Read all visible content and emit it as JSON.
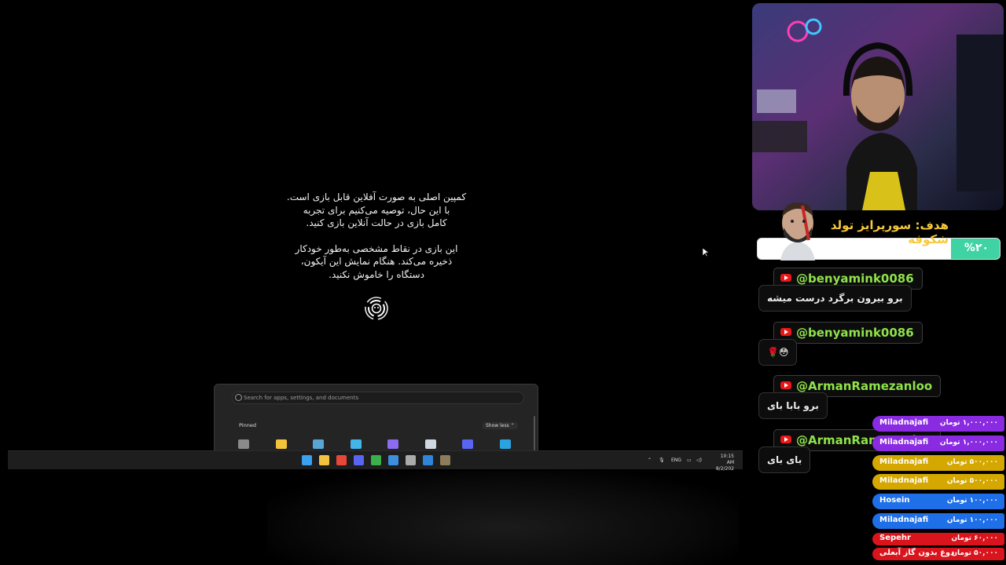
{
  "game": {
    "notice_paragraph_1": [
      "کمپین اصلی به صورت آفلاین قابل بازی است.",
      "با این حال، توصیه می‌کنیم برای تجربه",
      "کامل بازی در حالت آنلاین بازی کنید."
    ],
    "notice_paragraph_2": [
      "این بازی در نقاط مشخصی به‌طور خودکار",
      "ذخیره می‌کند. هنگام نمایش این آیکون،",
      "دستگاه را خاموش نکنید."
    ],
    "spinner_icon": "swirl-save-icon"
  },
  "start_menu": {
    "search_placeholder": "Search for apps, settings, and documents",
    "pinned_label": "Pinned",
    "show_less_label": "Show less ⌃",
    "apps": [
      {
        "icon": "settings-icon",
        "color": "#8a8a8a"
      },
      {
        "icon": "folder-icon",
        "color": "#f3c43a"
      },
      {
        "icon": "app-icon",
        "color": "#58a6d6"
      },
      {
        "icon": "monitor-icon",
        "color": "#42b6e8"
      },
      {
        "icon": "app-icon",
        "color": "#8b6cf0"
      },
      {
        "icon": "steam-icon",
        "color": "#cfd8e0"
      },
      {
        "icon": "discord-icon",
        "color": "#5865f2"
      },
      {
        "icon": "telegram-icon",
        "color": "#2aa3e0"
      }
    ]
  },
  "taskbar": {
    "apps": [
      {
        "icon": "windows-start-icon",
        "color": "#3aa0f0"
      },
      {
        "icon": "file-explorer-icon",
        "color": "#f1c33f"
      },
      {
        "icon": "chrome-icon",
        "color": "#e9463a"
      },
      {
        "icon": "discord-icon",
        "color": "#5865f2"
      },
      {
        "icon": "xbox-icon",
        "color": "#3bb04a"
      },
      {
        "icon": "app-icon",
        "color": "#3d8de0"
      },
      {
        "icon": "obs-icon",
        "color": "#aaaaaa"
      },
      {
        "icon": "mail-icon",
        "color": "#2f86d8"
      },
      {
        "icon": "game-icon",
        "color": "#8c7c5a"
      }
    ],
    "tray_lang": "ENG",
    "clock_time": "10:15 AM",
    "clock_date": "8/2/202"
  },
  "goal": {
    "title": "هدف: سورپرایز تولد شکوفه",
    "percent_label": "%۲۰",
    "percent_value": 0.2,
    "fill_color": "#3fd3a4",
    "title_color": "#f4c93a"
  },
  "chat": [
    {
      "author": "@benyamink0086",
      "message": "برو بیرون برگرد درست میشه"
    },
    {
      "author": "@benyamink0086",
      "message": "😳🌹"
    },
    {
      "author": "@ArmanRamezanloo",
      "message": "برو بابا بای"
    },
    {
      "author": "@ArmanRamezanloo",
      "message": "بای بای"
    }
  ],
  "donations": [
    {
      "name": "Miladnajafi",
      "amount": "۱,۰۰۰,۰۰۰ تومان",
      "color": "#8a2be2"
    },
    {
      "name": "Miladnajafi",
      "amount": "۱,۰۰۰,۰۰۰ تومان",
      "color": "#8a2be2"
    },
    {
      "name": "Miladnajafi",
      "amount": "۵۰۰,۰۰۰ تومان",
      "color": "#d4a800"
    },
    {
      "name": "Miladnajafi",
      "amount": "۵۰۰,۰۰۰ تومان",
      "color": "#d4a800"
    },
    {
      "name": "Hosein",
      "amount": "۱۰۰,۰۰۰ تومان",
      "color": "#1e6fe8"
    },
    {
      "name": "Miladnajafi",
      "amount": "۱۰۰,۰۰۰ تومان",
      "color": "#1e6fe8"
    },
    {
      "name": "Sepehr",
      "amount": "۶۰,۰۰۰ تومان",
      "color": "#d9141d"
    },
    {
      "name": "دوغ بدون گاز آبعلی",
      "amount": "۵۰,۰۰۰ تومان",
      "color": "#d9141d"
    }
  ]
}
